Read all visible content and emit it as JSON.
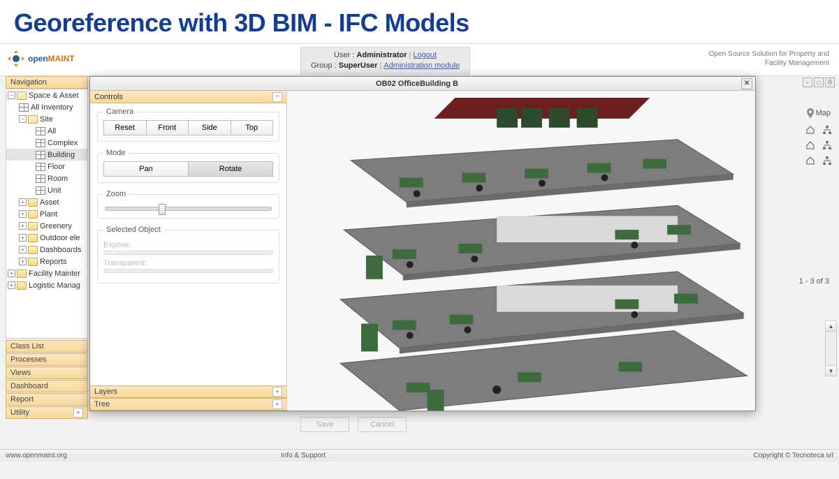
{
  "page_title": "Georeference with 3D BIM - IFC Models",
  "brand": {
    "part1": "open",
    "part2": "MAINT"
  },
  "user_panel": {
    "user_label": "User :",
    "user_name": "Administrator",
    "logout": "Logout",
    "group_label": "Group :",
    "group_name": "SuperUser",
    "admin_link": "Administration module"
  },
  "tagline": {
    "l1": "Open Source Solution for Property and",
    "l2": "Facility Management"
  },
  "nav": {
    "header": "Navigation",
    "root": "Space & Asset",
    "items": [
      "All Inventory",
      "Site"
    ],
    "site_children": [
      "All",
      "Complex",
      "Building",
      "Floor",
      "Room",
      "Unit"
    ],
    "selected": "Building",
    "folders": [
      "Asset",
      "Plant",
      "Greenery",
      "Outdoor ele",
      "Dashboards",
      "Reports"
    ],
    "extra": [
      "Facility Mainter",
      "Logistic Manag"
    ],
    "acc": [
      "Class List",
      "Processes",
      "Views",
      "Dashboard",
      "Report",
      "Utility"
    ]
  },
  "right": {
    "map_label": "Map",
    "pager": "1 - 3 of 3"
  },
  "actions": {
    "save": "Save",
    "cancel": "Cancel"
  },
  "modal": {
    "title": "OB02 OfficeBuilding B",
    "controls_header": "Controls",
    "camera_legend": "Camera",
    "camera_buttons": [
      "Reset",
      "Front",
      "Side",
      "Top"
    ],
    "mode_legend": "Mode",
    "mode_buttons": [
      "Pan",
      "Rotate"
    ],
    "mode_active": "Rotate",
    "zoom_legend": "Zoom",
    "sel_legend": "Selected Object",
    "sel_labels": [
      "Expose:",
      "Transparent:"
    ],
    "panel_acc": [
      "Layers",
      "Tree"
    ]
  },
  "footer": {
    "left": "www.openmaint.org",
    "mid": "Info & Support",
    "right": "Copyright © Tecnoteca srl"
  }
}
